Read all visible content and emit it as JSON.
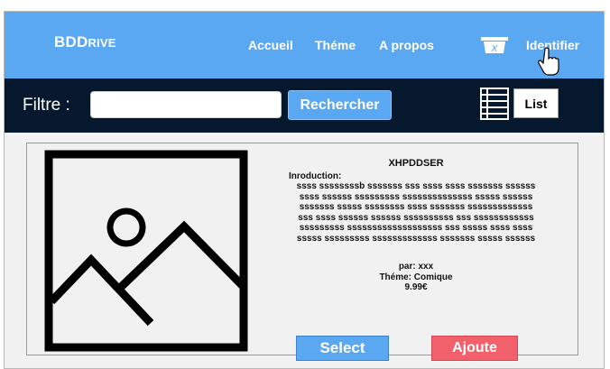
{
  "header": {
    "logo_main": "BDD",
    "logo_small": "RIVE",
    "nav": [
      "Accueil",
      "Théme",
      "A propos"
    ],
    "cart_icon": "cart-icon",
    "cart_label": "X",
    "login_label": "Identifier"
  },
  "filter": {
    "label": "Filtre :",
    "input_value": "",
    "search_label": "Rechercher",
    "list_icon": "list-view-icon",
    "list_label": "List"
  },
  "product": {
    "image_icon": "image-placeholder-icon",
    "title": "XHPDDSER",
    "intro_label": "Inroduction:",
    "description_lines": [
      "ssss ssssssssb sssssss sss ssss ssss sssssss ssssss",
      "ssss ssssss sssssssss ssssssssssssss sssss ssssss",
      "sssssss sssss ssssssss ssss sssssss sssssssssssss",
      "sss  ssss ssssss ssssss ssssssssss sss ssssssssssss",
      "sssssssss sssssssssssssssssss sss sssss ssss ssss",
      "sssss sssssssss sssssssssssss sssssss sssss ssssss"
    ],
    "author": "par: xxx",
    "theme": "Théme: Comique",
    "price": "9.99€",
    "select_label": "Select",
    "add_label": "Ajoute"
  },
  "colors": {
    "nav_bg": "#5aa7f2",
    "filter_bg": "#05182d",
    "select_btn": "#5aa7f2",
    "add_btn": "#f2606b"
  }
}
